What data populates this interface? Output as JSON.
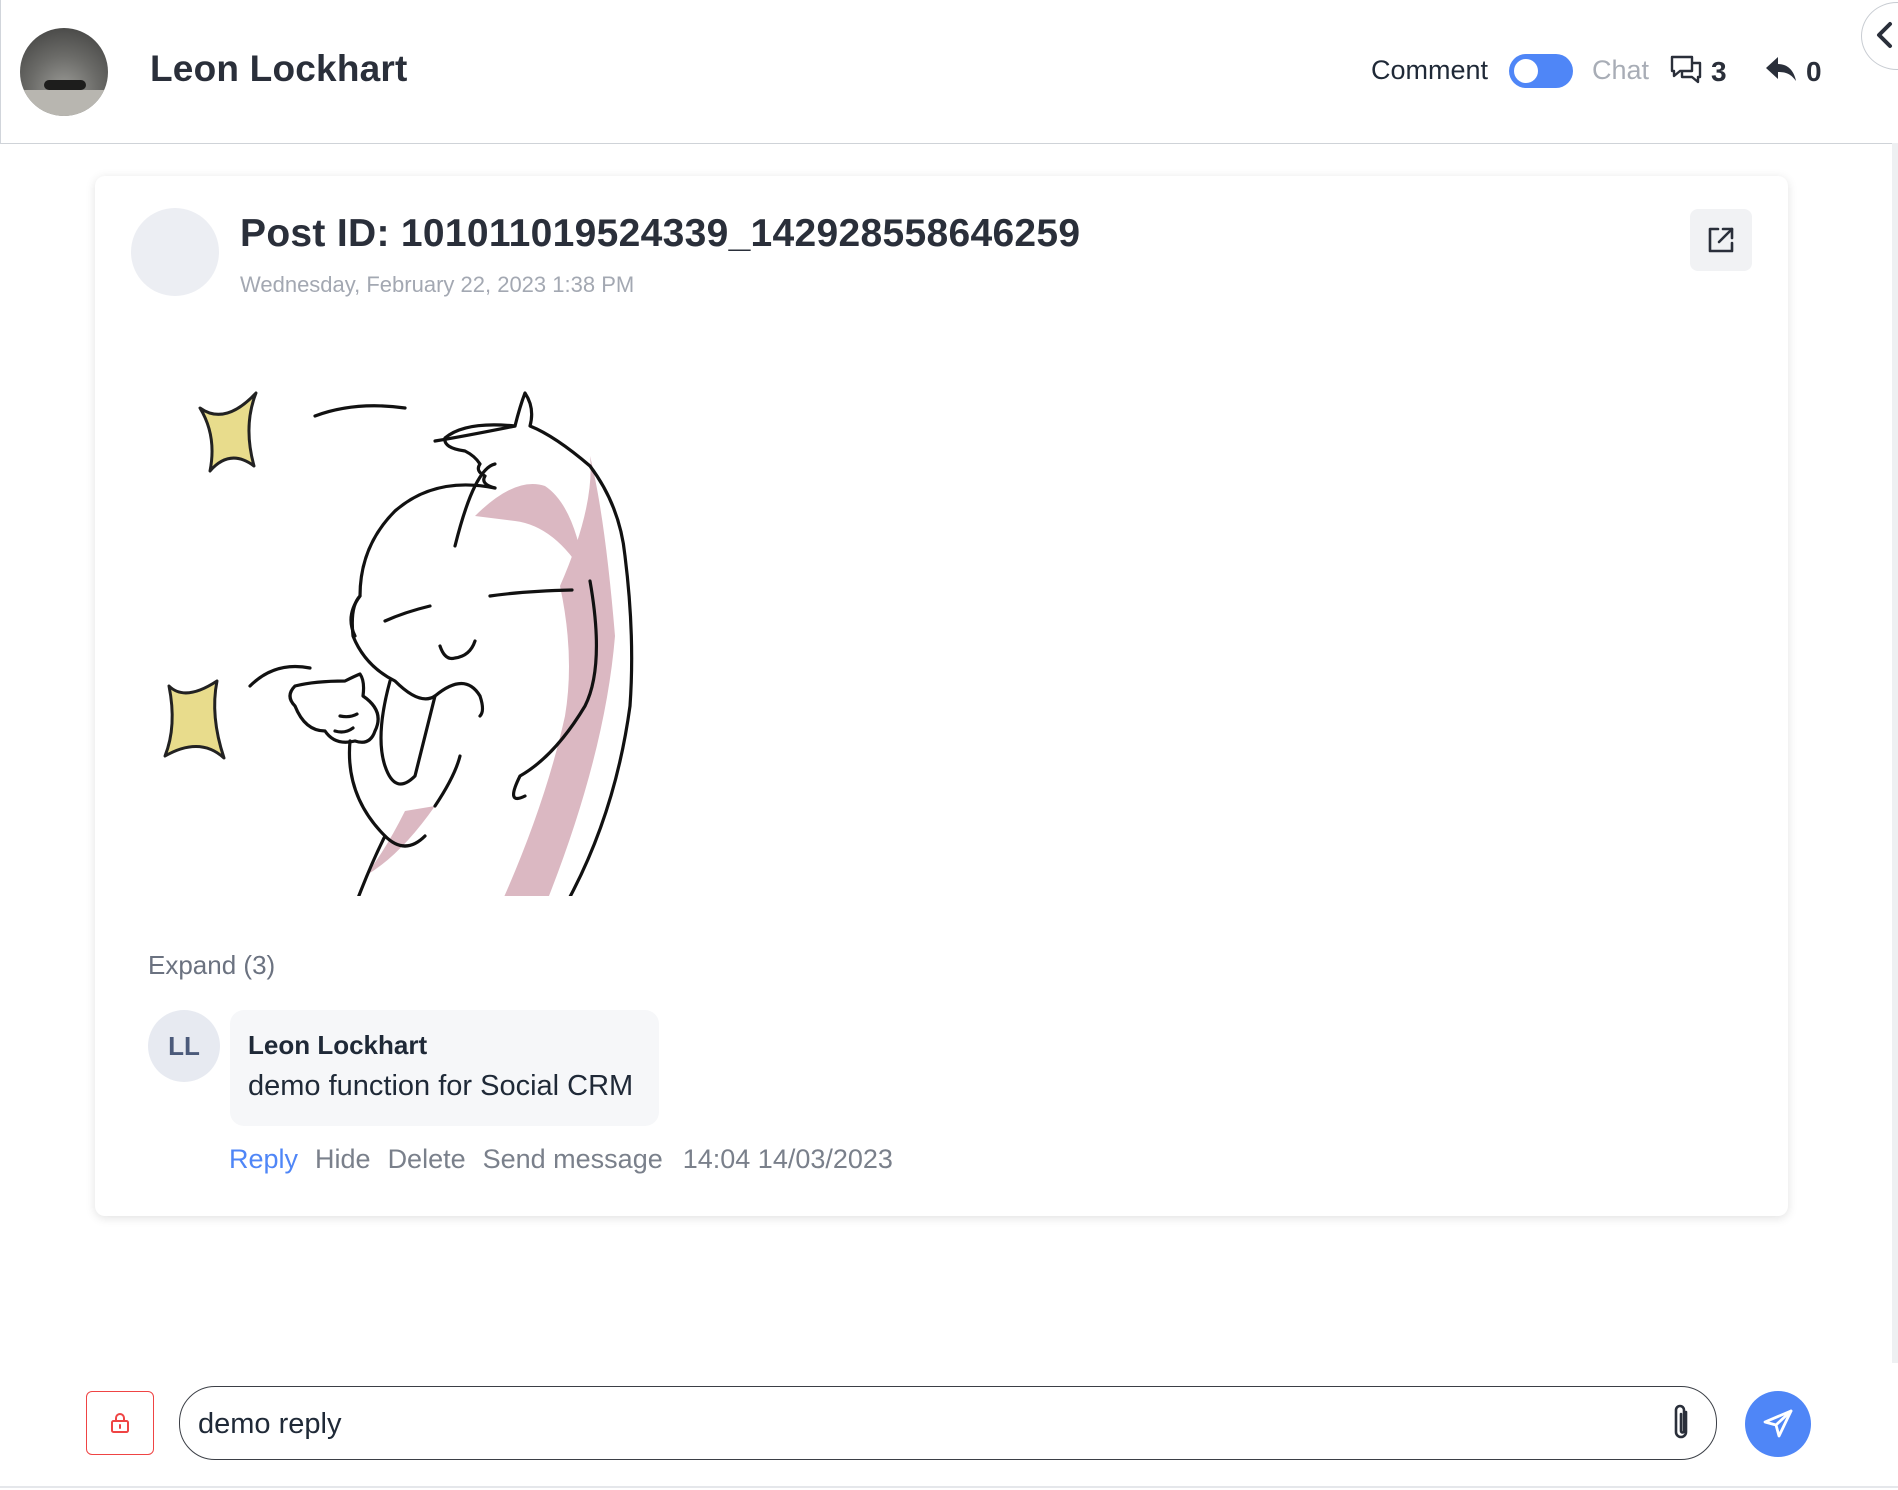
{
  "header": {
    "contact_name": "Leon Lockhart",
    "mode_comment": "Comment",
    "mode_chat": "Chat",
    "comment_count": "3",
    "reply_count": "0"
  },
  "post": {
    "title": "Post ID: 101011019524339_142928558646259",
    "date": "Wednesday, February 22, 2023 1:38 PM",
    "expand_label": "Expand (3)"
  },
  "comment": {
    "initials": "LL",
    "author": "Leon Lockhart",
    "text": "demo function for Social CRM",
    "actions": {
      "reply": "Reply",
      "hide": "Hide",
      "delete": "Delete",
      "send_message": "Send message"
    },
    "timestamp": "14:04 14/03/2023"
  },
  "composer": {
    "value": "demo reply "
  },
  "colors": {
    "accent": "#4f86f7",
    "danger": "#ef4444",
    "sticker_star": "#e8dc8c",
    "sticker_shade": "#dbb8c2"
  },
  "icons": {
    "comments": "chat-bubbles-icon",
    "replies": "reply-arrow-icon",
    "open_external": "external-link-icon",
    "lock": "lock-icon",
    "attach": "paperclip-icon",
    "send": "send-icon",
    "collapse": "chevron-left-icon"
  }
}
